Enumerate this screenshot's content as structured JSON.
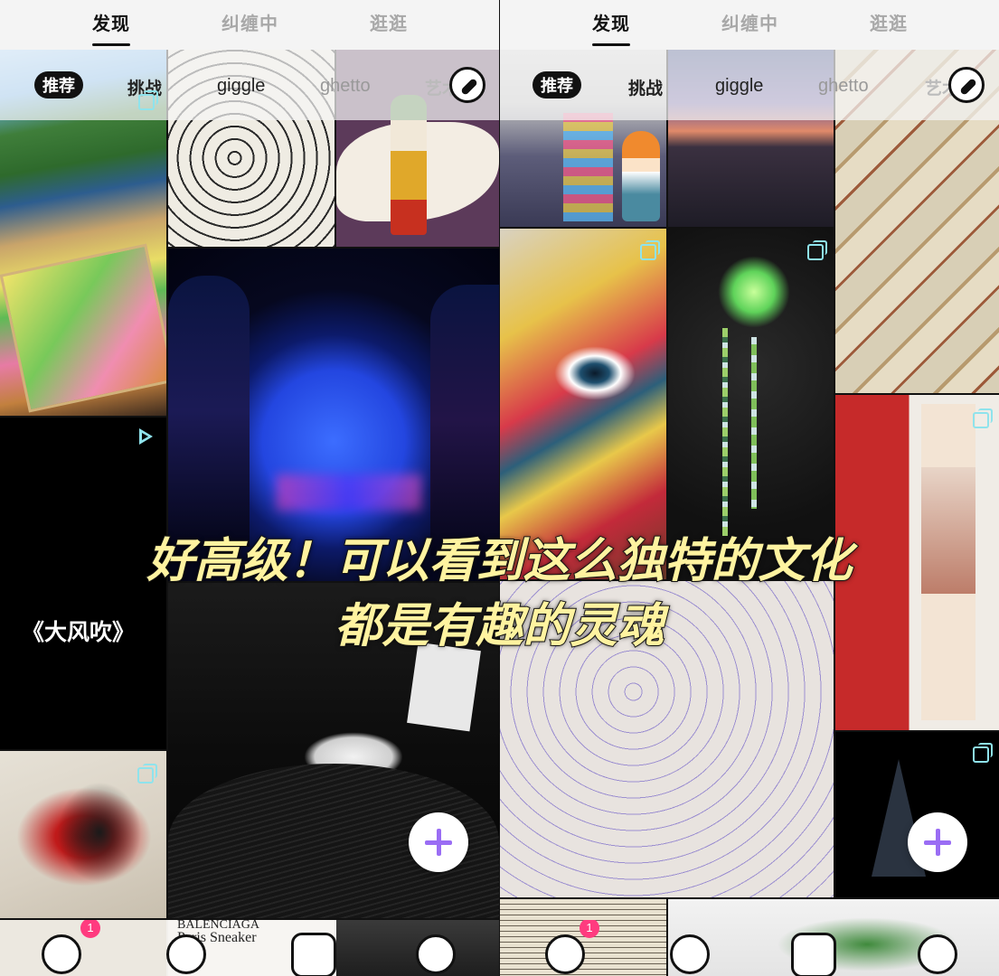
{
  "top_tabs": [
    "发现",
    "纠缠中",
    "逛逛"
  ],
  "chips": [
    "推荐",
    "挑战",
    "giggle",
    "ghetto",
    "艺术"
  ],
  "video_title": "《大风吹》",
  "caption": {
    "line1": "好高级！可以看到这么独特的文化",
    "line2": "都是有趣的灵魂"
  },
  "bottom_texts": {
    "balenciaga": "BALENCIAGA",
    "sneaker": "Paris Sneaker"
  },
  "badge_count": "1",
  "colors": {
    "accent": "#9a6df4",
    "caption": "#fff3a0",
    "badge": "#ff3b7f"
  }
}
